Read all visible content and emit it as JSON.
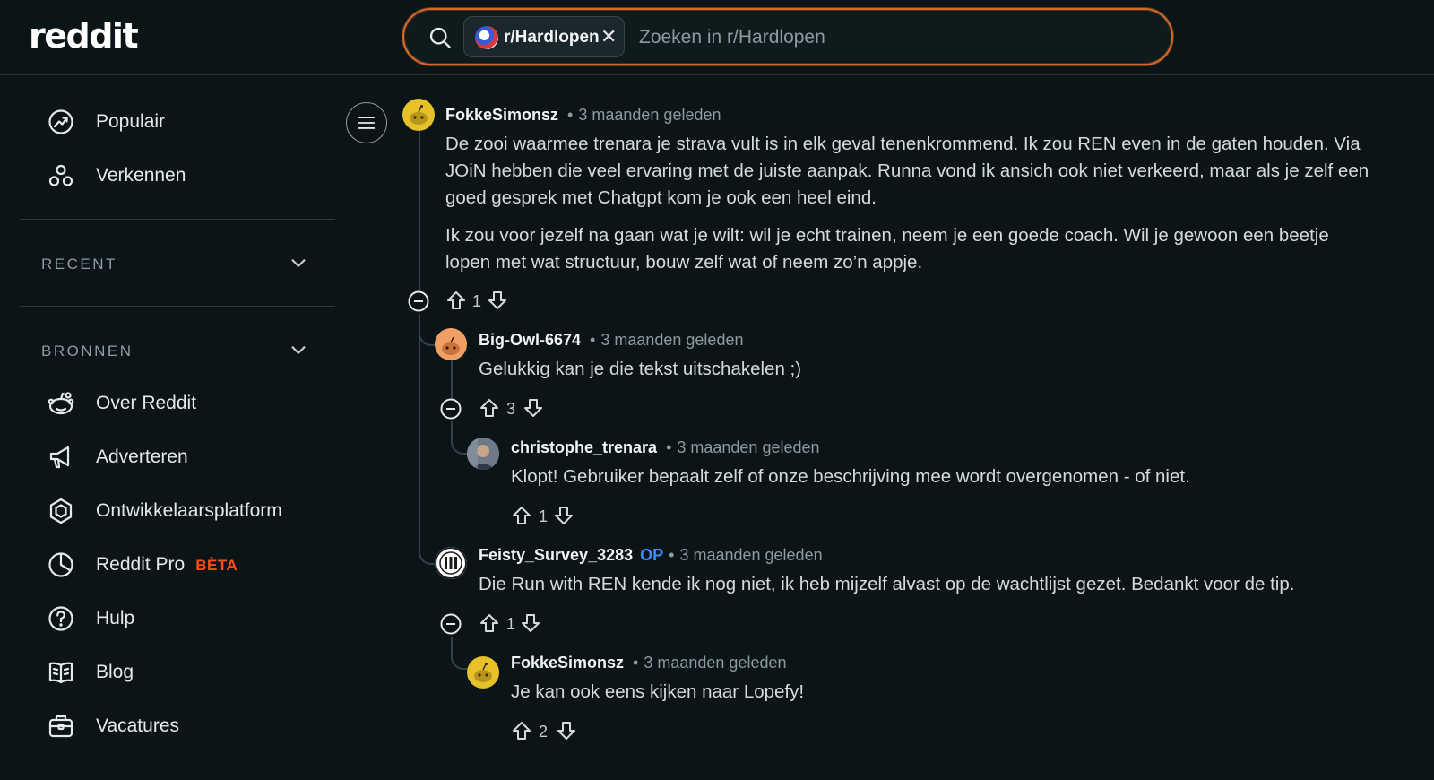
{
  "header": {
    "logo": "reddit",
    "search": {
      "chip_label": "r/Hardlopen",
      "chip_close": "✕",
      "placeholder": "Zoeken in r/Hardlopen"
    }
  },
  "sidebar": {
    "top_items": [
      {
        "label": "Populair",
        "icon": "popular-icon"
      },
      {
        "label": "Verkennen",
        "icon": "explore-icon"
      }
    ],
    "sections": {
      "recent": "RECENT",
      "bronnen": "BRONNEN"
    },
    "resources": [
      {
        "label": "Over Reddit",
        "icon": "reddit-alien-icon"
      },
      {
        "label": "Adverteren",
        "icon": "megaphone-icon"
      },
      {
        "label": "Ontwikkelaarsplatform",
        "icon": "developer-platform-icon"
      },
      {
        "label": "Reddit Pro",
        "badge": "BÈTA",
        "icon": "pie-chart-icon"
      },
      {
        "label": "Hulp",
        "icon": "help-icon"
      },
      {
        "label": "Blog",
        "icon": "book-icon"
      },
      {
        "label": "Vacatures",
        "icon": "briefcase-icon"
      }
    ]
  },
  "colors": {
    "background": "#0b1416",
    "accent_orange": "#ff4d1a",
    "op_blue": "#3d8bfd",
    "search_border": "#d9662b"
  },
  "comments": [
    {
      "author": "FokkeSimonsz",
      "time": "3 maanden geleden",
      "paragraphs": [
        "De zooi waarmee trenara je strava vult is in elk geval tenenkrommend. Ik zou REN even in de gaten houden. Via JOiN hebben die veel ervaring met de juiste aanpak. Runna vond ik ansich ook niet verkeerd, maar als je zelf een goed gesprek met Chatgpt kom je ook een heel eind.",
        "Ik zou voor jezelf na gaan wat je wilt: wil je echt trainen, neem je een goede coach. Wil je gewoon een beetje lopen met wat structuur, bouw zelf wat of neem zo’n appje."
      ],
      "score": "1"
    },
    {
      "author": "Big-Owl-6674",
      "time": "3 maanden geleden",
      "paragraphs": [
        "Gelukkig kan je die tekst uitschakelen ;)"
      ],
      "score": "3"
    },
    {
      "author": "christophe_trenara",
      "time": "3 maanden geleden",
      "paragraphs": [
        "Klopt! Gebruiker bepaalt zelf of onze beschrijving mee wordt overgenomen - of niet."
      ],
      "score": "1"
    },
    {
      "author": "Feisty_Survey_3283",
      "badge": "OP",
      "time": "3 maanden geleden",
      "paragraphs": [
        "Die Run with REN kende ik nog niet, ik heb mijzelf alvast op de wachtlijst gezet. Bedankt voor de tip."
      ],
      "score": "1"
    },
    {
      "author": "FokkeSimonsz",
      "time": "3 maanden geleden",
      "paragraphs": [
        "Je kan ook eens kijken naar Lopefy!"
      ],
      "score": "2"
    }
  ],
  "dot": "•"
}
